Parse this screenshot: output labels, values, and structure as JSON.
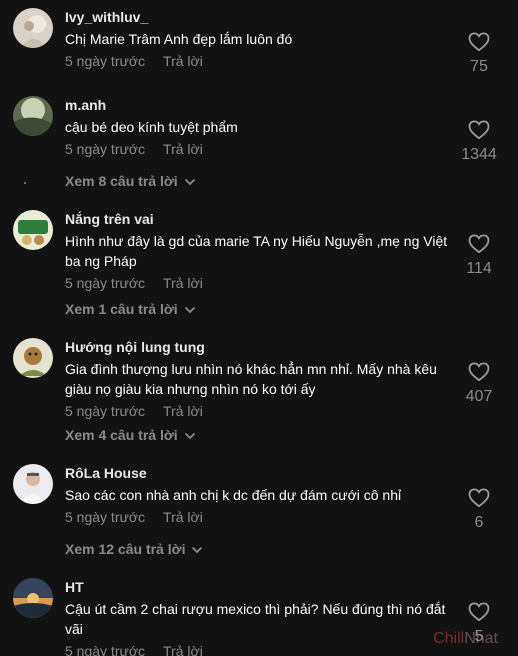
{
  "comments": [
    {
      "username": "Ivy_withluv_",
      "text": "Chị Marie Trâm Anh đẹp lắm luôn đó",
      "time": "5 ngày trước",
      "reply_label": "Trả lời",
      "likes": "75",
      "view_replies": ""
    },
    {
      "username": "m.anh",
      "text": "cậu bé deo kính tuyệt phẩm",
      "time": "5 ngày trước",
      "reply_label": "Trả lời",
      "likes": "1344",
      "view_replies": "Xem 8 câu trả lời"
    },
    {
      "username": "Nắng trên vai",
      "text": "Hình như đây là gd của marie TA ny Hiếu Nguyễn ,mẹ ng Việt ba ng Pháp",
      "time": "5 ngày trước",
      "reply_label": "Trả lời",
      "likes": "114",
      "view_replies": "Xem 1 câu trả lời"
    },
    {
      "username": "Hướng nội lung tung",
      "text": "Gia đình thượng lưu nhìn nó khác hẳn mn nhỉ. Mấy nhà kêu giàu nọ giàu kia nhưng nhìn nó ko tới ấy",
      "time": "5 ngày trước",
      "reply_label": "Trả lời",
      "likes": "407",
      "view_replies": "Xem 4 câu trả lời"
    },
    {
      "username": "RôLa House",
      "text": "Sao các con nhà anh chị k dc đến dự đám cưới cô nhỉ",
      "time": "5 ngày trước",
      "reply_label": "Trả lời",
      "likes": "6",
      "view_replies": "Xem 12 câu trả lời"
    },
    {
      "username": "HT",
      "text": "Cậu út cầm 2 chai rượu mexico thì phải? Nếu đúng thì nó đắt vãi",
      "time": "5 ngày trước",
      "reply_label": "Trả lời",
      "likes": "5",
      "view_replies": ""
    }
  ],
  "watermark": {
    "part1": "Chill",
    "part2": "Nhat"
  },
  "colors": {
    "background": "#121212",
    "muted_text": "#8a8b91",
    "primary_text": "#ffffff"
  },
  "icons": {
    "like": "heart-outline-icon",
    "expand": "chevron-down-icon"
  }
}
